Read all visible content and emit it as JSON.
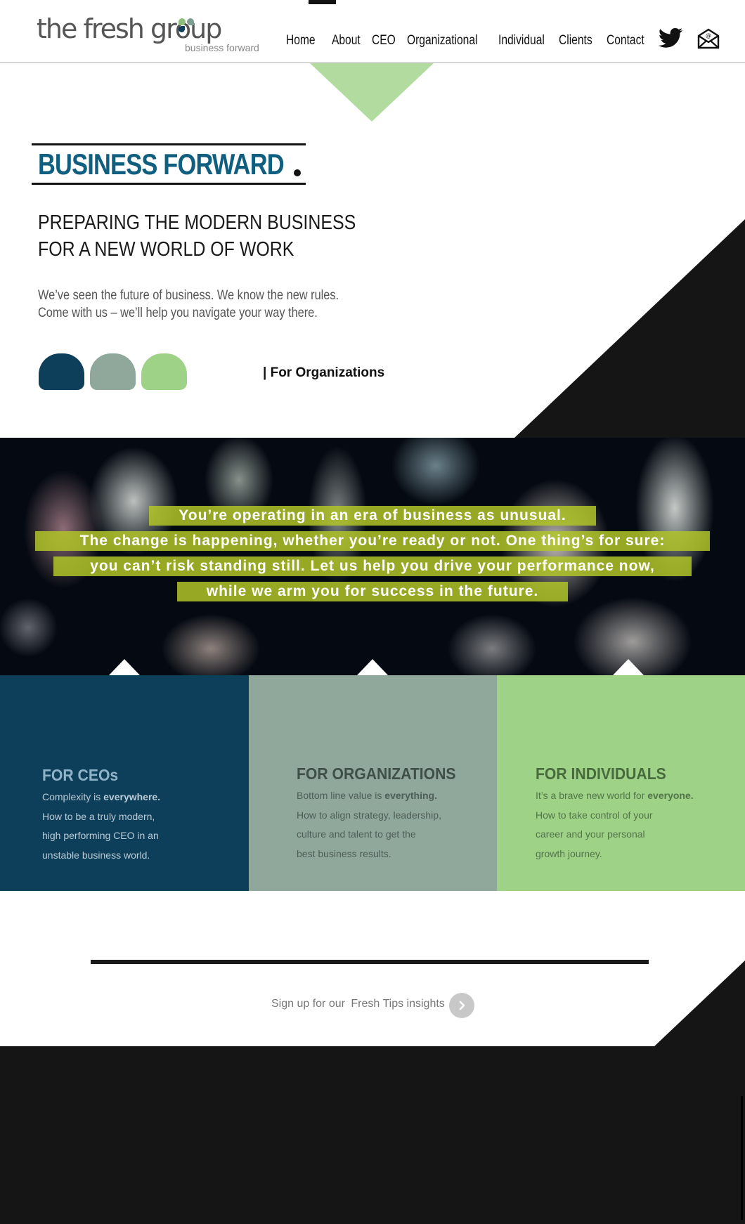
{
  "brand": {
    "name": "the fresh group",
    "tagline": "business forward",
    "dot_colors": [
      "#8dbf7a",
      "#0e3f5a",
      "#7f9e92"
    ]
  },
  "nav": {
    "items": [
      "Home",
      "About",
      "CEO",
      "Organizational",
      "Individual",
      "Clients",
      "Contact"
    ]
  },
  "social": {
    "twitter_icon": "twitter-bird-icon",
    "email_icon": "email-envelope-icon"
  },
  "hero": {
    "heading": "BUSINESS FORWARD",
    "headline_line1": "PREPARING THE MODERN BUSINESS",
    "headline_line2": "FOR A NEW WORLD OF WORK",
    "intro_line1": "We’ve seen the future of business. We know the new rules.",
    "intro_line2": "Come with us – we’ll help you navigate your way there.",
    "active_label": "|  For Organizations",
    "blob_colors": [
      "#0e3f5a",
      "#90a89b",
      "#9ed287"
    ]
  },
  "banner": {
    "lines": [
      "You’re operating in an era of business as unusual.",
      "The change is happening, whether you’re ready or not. One thing’s for sure:",
      "you can’t risk standing still. Let us help you drive your performance now,",
      "while we arm you for success in the future."
    ]
  },
  "columns": [
    {
      "title": "FOR CEOs",
      "lead": "Complexity is ",
      "lead_bold": "everywhere.",
      "lines": [
        "How to be a truly modern,",
        "high performing CEO in an",
        "unstable business world."
      ],
      "bg": "#0e3f5a"
    },
    {
      "title": "FOR ORGANIZATIONS",
      "lead": "Bottom line value is ",
      "lead_bold": "everything.",
      "lines": [
        "How to align strategy, leadership,",
        "culture and talent to get the",
        "best business results."
      ],
      "bg": "#90a89b"
    },
    {
      "title": "FOR INDIVIDUALS",
      "lead": "It’s a brave new world for ",
      "lead_bold": "everyone.",
      "lines": [
        "How to take control of your",
        "career and your personal",
        "growth journey."
      ],
      "bg": "#9ed287"
    }
  ],
  "signup": {
    "prefix": "Sign up for our",
    "link": "Fresh Tips insights",
    "button_icon": "chevron-right-icon"
  }
}
